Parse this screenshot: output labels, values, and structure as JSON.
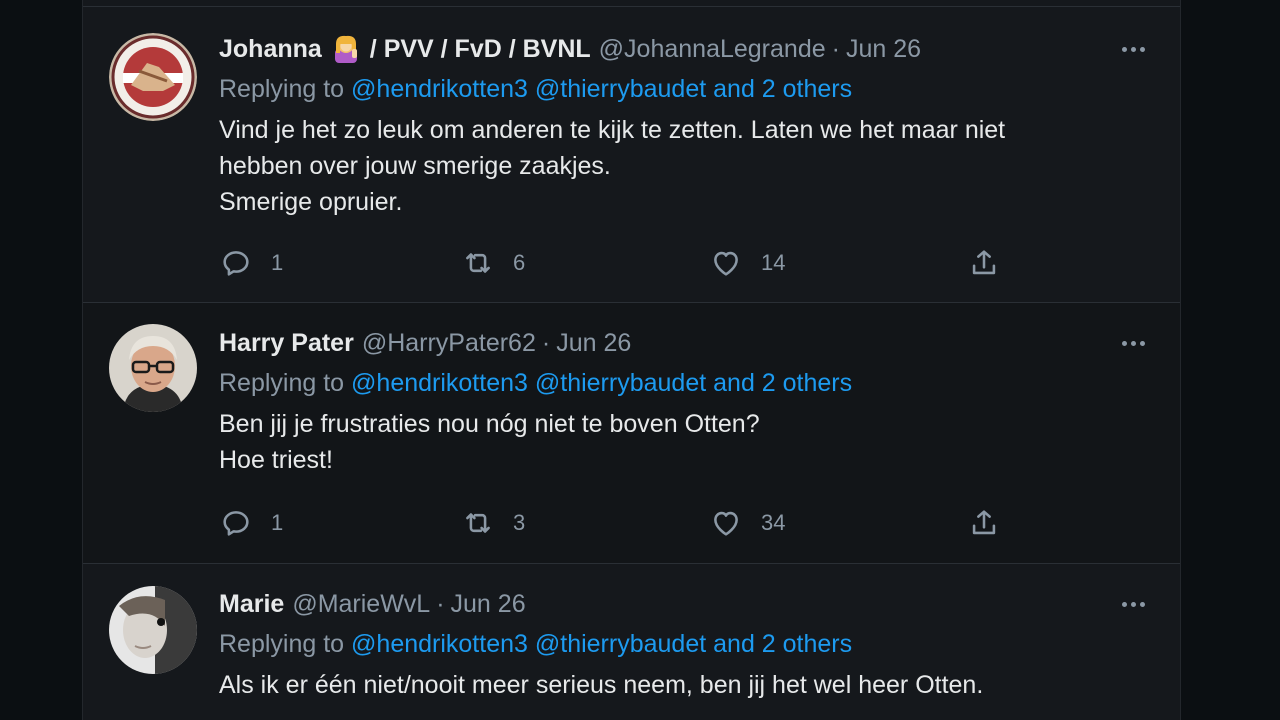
{
  "tweets": [
    {
      "name": "Johanna",
      "name_suffix": "/ PVV / FvD / BVNL",
      "handle": "@JohannaLegrande",
      "date": "Jun 26",
      "replying_prefix": "Replying to",
      "mentions": [
        "@hendrikotten3",
        "@thierrybaudet"
      ],
      "others": "and 2 others",
      "lines": [
        "Vind je het zo leuk om anderen te kijk te zetten. Laten we het maar niet",
        "hebben over jouw smerige zaakjes.",
        "Smerige opruier."
      ],
      "replies": "1",
      "retweets": "6",
      "likes": "14"
    },
    {
      "name": "Harry Pater",
      "handle": "@HarryPater62",
      "date": "Jun 26",
      "replying_prefix": "Replying to",
      "mentions": [
        "@hendrikotten3",
        "@thierrybaudet"
      ],
      "others": "and 2 others",
      "lines": [
        "Ben jij je frustraties nou nóg niet te boven Otten?",
        "Hoe triest!"
      ],
      "replies": "1",
      "retweets": "3",
      "likes": "34"
    },
    {
      "name": "Marie",
      "handle": "@MarieWvL",
      "date": "Jun 26",
      "replying_prefix": "Replying to",
      "mentions": [
        "@hendrikotten3",
        "@thierrybaudet"
      ],
      "others": "and 2 others",
      "lines": [
        "Als ik er één niet/nooit meer serieus neem, ben jij het wel heer Otten."
      ]
    }
  ],
  "colors": {
    "background": "#15181c",
    "text": "#e7e9ea",
    "muted": "#8b98a5",
    "link": "#1d9bf0"
  },
  "icons": [
    "reply-icon",
    "retweet-icon",
    "like-icon",
    "share-icon",
    "more-icon",
    "woman-emoji-icon"
  ]
}
